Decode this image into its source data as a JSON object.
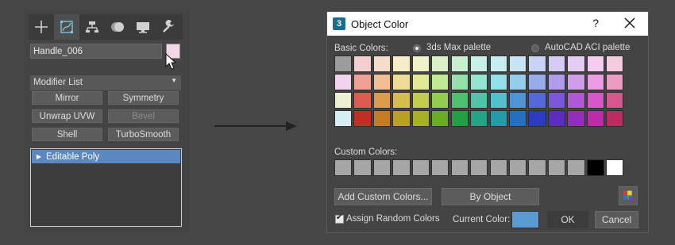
{
  "command_panel": {
    "tabs": [
      {
        "icon": "plus-icon",
        "active": false
      },
      {
        "icon": "modify-icon",
        "active": true
      },
      {
        "icon": "hierarchy-icon",
        "active": false
      },
      {
        "icon": "motion-icon",
        "active": false
      },
      {
        "icon": "display-icon",
        "active": false
      },
      {
        "icon": "utilities-icon",
        "active": false
      }
    ],
    "object_name": "Handle_006",
    "object_color": "#f3d6ea",
    "modifier_list": "Modifier List",
    "buttons": [
      {
        "label": "Mirror",
        "enabled": true
      },
      {
        "label": "Symmetry",
        "enabled": true
      },
      {
        "label": "Unwrap UVW",
        "enabled": true
      },
      {
        "label": "Bevel",
        "enabled": false
      },
      {
        "label": "Shell",
        "enabled": true
      },
      {
        "label": "TurboSmooth",
        "enabled": true
      }
    ],
    "stack": [
      "Editable Poly"
    ]
  },
  "dialog": {
    "title": "Object Color",
    "help": "?",
    "basic_colors_label": "Basic Colors:",
    "palette_options": [
      {
        "label": "3ds Max palette",
        "checked": true
      },
      {
        "label": "AutoCAD ACI palette",
        "checked": false
      }
    ],
    "basic_colors": [
      [
        "#9c9c9c",
        "#f4cfcf",
        "#f5dcc8",
        "#f6ecc8",
        "#eef0c8",
        "#dcf0c8",
        "#c8f0d0",
        "#c8f0e6",
        "#c8eef0",
        "#c8e4f4",
        "#c8d4f4",
        "#d4ccf4",
        "#e4ccf4",
        "#f4ccf0",
        "#f4cce0"
      ],
      [
        "#f4d2ee",
        "#f0a094",
        "#f0c094",
        "#eedc94",
        "#e0ea94",
        "#c0ea94",
        "#94e0a8",
        "#94e4d0",
        "#94e0e8",
        "#94ccec",
        "#98acec",
        "#b09cec",
        "#d09cec",
        "#ec9ce6",
        "#ec9cc0"
      ],
      [
        "#eef0d4",
        "#dc5c50",
        "#dc9c50",
        "#d4bc50",
        "#c4cc50",
        "#94cc50",
        "#50c070",
        "#50c4a8",
        "#50c0cc",
        "#5094d8",
        "#5468d8",
        "#7c58d8",
        "#b058d8",
        "#d458c8",
        "#d4588c"
      ],
      [
        "#d4eef4",
        "#c42c24",
        "#c47c24",
        "#bca024",
        "#a8b024",
        "#6cac24",
        "#24a044",
        "#24a484",
        "#249ca8",
        "#2470c0",
        "#2c3cc0",
        "#5c2cc0",
        "#942cc0",
        "#bc2ca8",
        "#bc2c64"
      ]
    ],
    "custom_colors_label": "Custom Colors:",
    "custom_colors": [
      "#a6a6a6",
      "#a6a6a6",
      "#a6a6a6",
      "#a6a6a6",
      "#a6a6a6",
      "#a6a6a6",
      "#a6a6a6",
      "#a6a6a6",
      "#a6a6a6",
      "#a6a6a6",
      "#a6a6a6",
      "#a6a6a6",
      "#a6a6a6",
      "#000000",
      "#ffffff"
    ],
    "add_custom_label": "Add Custom Colors...",
    "by_object_label": "By Object",
    "assign_random_label": "Assign Random Colors",
    "assign_random_checked": true,
    "current_color_label": "Current Color:",
    "current_color": "#5b9bd5",
    "ok_label": "OK",
    "cancel_label": "Cancel"
  }
}
